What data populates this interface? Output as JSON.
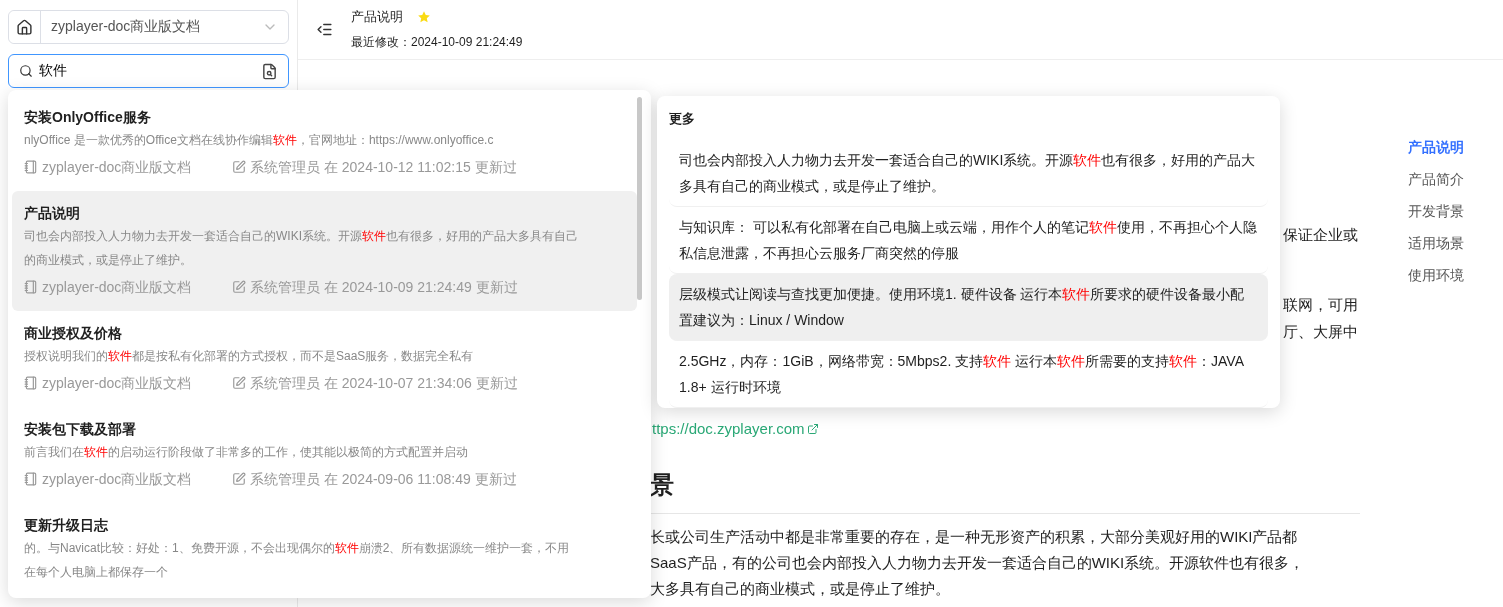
{
  "sidebar": {
    "space_select": {
      "value": "zyplayer-doc商业版文档"
    },
    "search": {
      "value": "软件"
    }
  },
  "header": {
    "title": "产品说明",
    "starred": true,
    "modified": "最近修改：2024-10-09 21:24:49"
  },
  "article": {
    "fragments": [
      "保证企业或",
      "联网，可用",
      "厅、大屏中"
    ],
    "link": "ttps://doc.zyplayer.com",
    "heading": "景",
    "paragraph": [
      "长或公司生产活动中都是非常重要的存在，是一种无形资产的积累，大部分美观好用的WIKI产品都",
      "SaaS产品，有的公司也会内部投入人力物力去开发一套适合自己的WIKI系统。开源软件也有很多，",
      "大多具有自己的商业模式，或是停止了维护。"
    ]
  },
  "toc": [
    {
      "label": "产品说明",
      "selected": true
    },
    {
      "label": "产品简介",
      "selected": false
    },
    {
      "label": "开发背景",
      "selected": false
    },
    {
      "label": "适用场景",
      "selected": false
    },
    {
      "label": "使用环境",
      "selected": false
    }
  ],
  "search_results": [
    {
      "title": "安装OnlyOffice服务",
      "snippet": "nlyOffice 是一款优秀的Office文档在线协作编辑**软件**，官网地址：https://www.onlyoffice.c",
      "space": "zyplayer-doc商业版文档",
      "meta": "系统管理员 在 2024-10-12 11:02:15 更新过",
      "selected": false
    },
    {
      "title": "产品说明",
      "snippet": "司也会内部投入人力物力去开发一套适合自己的WIKI系统。开源**软件**也有很多，好用的产品大多具有自己的商业模式，或是停止了维护。",
      "space": "zyplayer-doc商业版文档",
      "meta": "系统管理员 在 2024-10-09 21:24:49 更新过",
      "selected": true
    },
    {
      "title": "商业授权及价格",
      "snippet": "授权说明我们的**软件**都是按私有化部署的方式授权，而不是SaaS服务，数据完全私有",
      "space": "zyplayer-doc商业版文档",
      "meta": "系统管理员 在 2024-10-07 21:34:06 更新过",
      "selected": false
    },
    {
      "title": "安装包下载及部署",
      "snippet": "前言我们在**软件**的启动运行阶段做了非常多的工作，使其能以极简的方式配置并启动",
      "space": "zyplayer-doc商业版文档",
      "meta": "系统管理员 在 2024-09-06 11:08:49 更新过",
      "selected": false
    },
    {
      "title": "更新升级日志",
      "snippet": "的。与Navicat比较：好处：1、免费开源，不会出现偶尔的**软件**崩溃2、所有数据源统一维护一套，不用在每个人电脑上都保存一个",
      "selected": false
    }
  ],
  "more_popover": {
    "title": "更多",
    "items": [
      {
        "text": "司也会内部投入人力物力去开发一套适合自己的WIKI系统。开源**软件**也有很多，好用的产品大多具有自己的商业模式，或是停止了维护。",
        "selected": false
      },
      {
        "text": "与知识库： 可以私有化部署在自己电脑上或云端，用作个人的笔记**软件**使用，不再担心个人隐私信息泄露，不再担心云服务厂商突然的停服",
        "selected": false
      },
      {
        "text": "层级模式让阅读与查找更加便捷。使用环境1. 硬件设备 运行本**软件**所要求的硬件设备最小配置建议为：Linux / Window",
        "selected": true
      },
      {
        "text": "2.5GHz，内存：1GiB，网络带宽：5Mbps2. 支持**软件** 运行本**软件**所需要的支持**软件**：JAVA 1.8+ 运行时环境",
        "selected": false
      }
    ]
  }
}
